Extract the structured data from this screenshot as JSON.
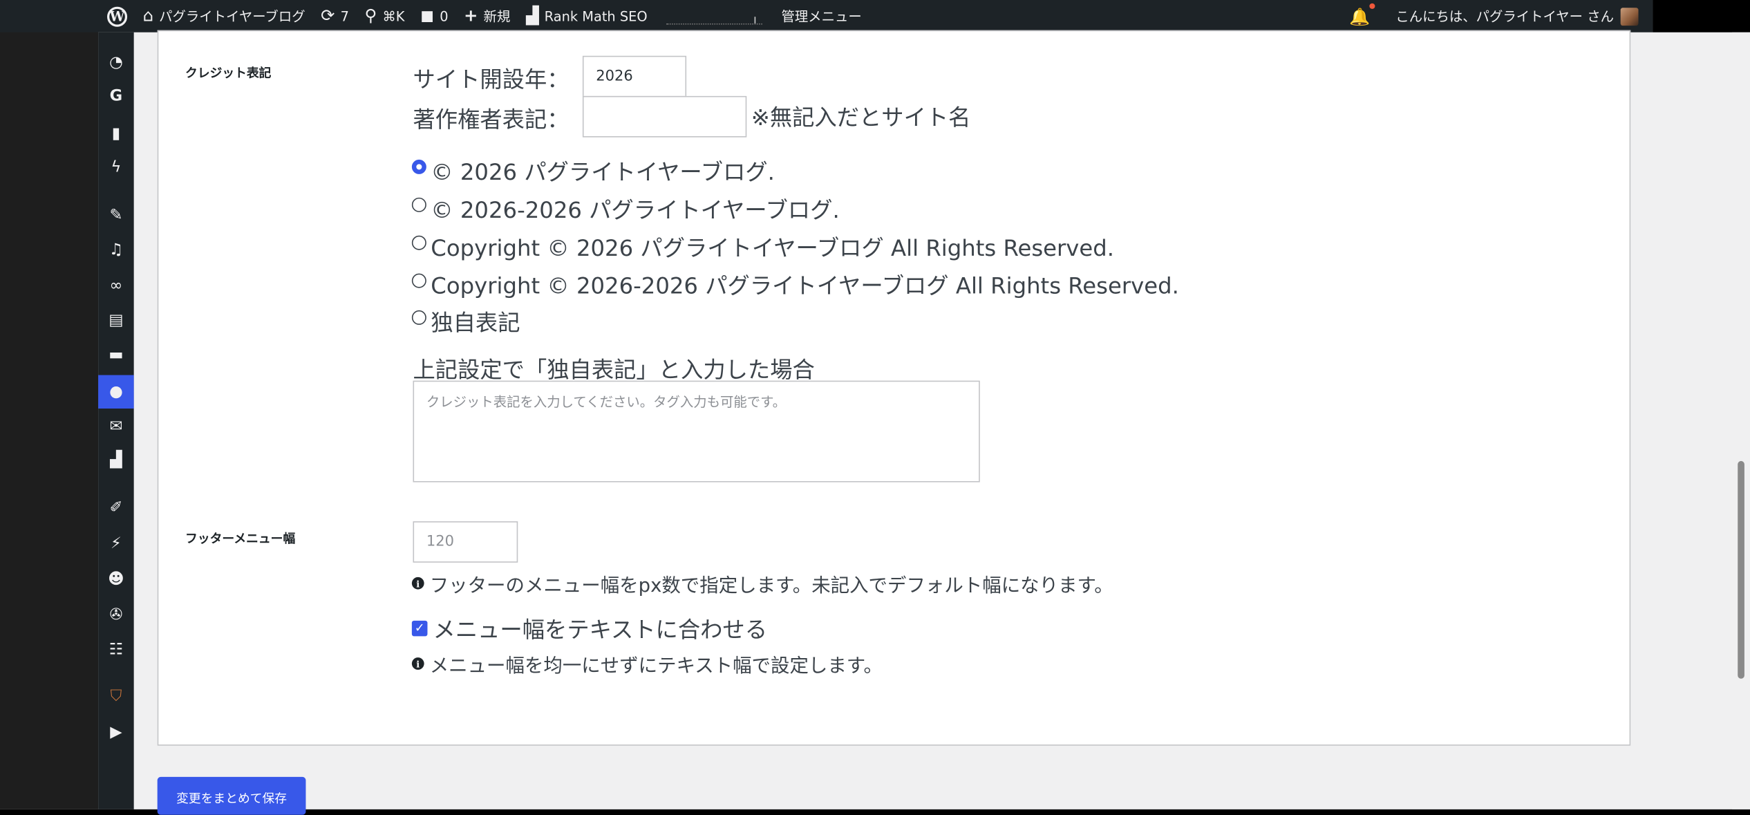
{
  "adminbar": {
    "site_name": "パグライトイヤーブログ",
    "updates_count": "7",
    "search_shortcut": "⌘K",
    "comments_count": "0",
    "new_label": "新規",
    "rankmath_label": "Rank Math SEO",
    "admin_menu_label": "管理メニュー",
    "greeting": "こんにちは、パグライトイヤー さん"
  },
  "sidebar": {
    "icons": [
      "dashboard-icon",
      "google-icon",
      "stats-icon",
      "performance-icon",
      "posts-icon",
      "media-icon",
      "links-icon",
      "pages-icon",
      "comments-icon",
      "theme-icon",
      "mail-icon",
      "rankmath-icon",
      "appearance-icon",
      "plugins-icon",
      "users-icon",
      "tools-icon",
      "settings-icon",
      "shield-icon",
      "play-icon"
    ],
    "active": "theme-icon"
  },
  "credit": {
    "label": "クレジット表記",
    "year_label": "サイト開設年：",
    "year_value": "2026",
    "holder_label": "著作権者表記：",
    "holder_value": "",
    "holder_note": "※無記入だとサイト名",
    "options": [
      "© 2026 パグライトイヤーブログ.",
      "© 2026-2026 パグライトイヤーブログ.",
      "Copyright © 2026 パグライトイヤーブログ All Rights Reserved.",
      "Copyright © 2026-2026 パグライトイヤーブログ All Rights Reserved.",
      "独自表記"
    ],
    "selected_index": 0,
    "custom_label": "上記設定で「独自表記」と入力した場合",
    "custom_placeholder": "クレジット表記を入力してください。タグ入力も可能です。"
  },
  "footer_menu": {
    "label": "フッターメニュー幅",
    "width_placeholder": "120",
    "width_help": "フッターのメニュー幅をpx数で指定します。未記入でデフォルト幅になります。",
    "fit_label": "メニュー幅をテキストに合わせる",
    "fit_checked": true,
    "fit_help": "メニュー幅を均一にせずにテキスト幅で設定します。"
  },
  "save_button": "変更をまとめて保存",
  "colors": {
    "accent": "#3858e9",
    "adminbar": "#1d2327"
  }
}
